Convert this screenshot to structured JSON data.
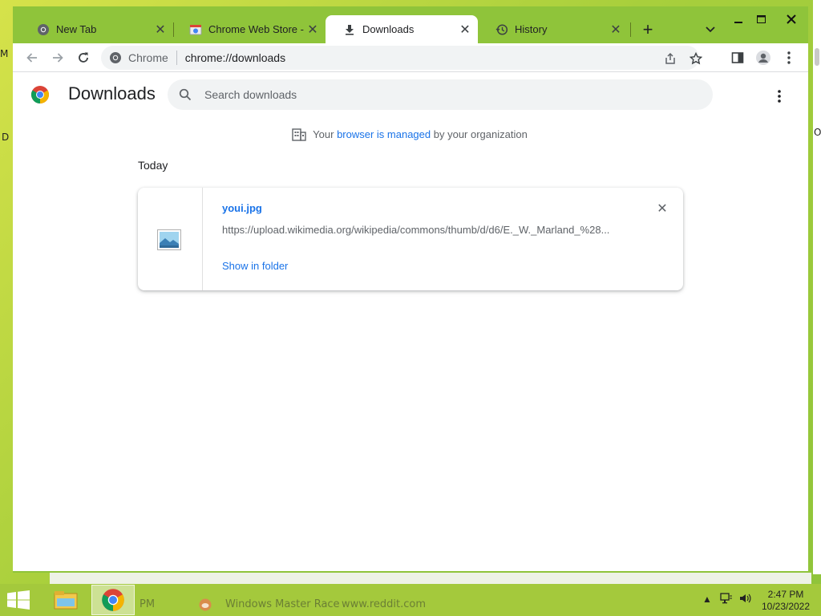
{
  "desktop": {
    "left_fragment_1": "M",
    "left_fragment_2": "D",
    "right_fragment": "O"
  },
  "tabs": [
    {
      "title": "New Tab",
      "icon": "chrome-icon",
      "active": false
    },
    {
      "title": "Chrome Web Store - Ex",
      "icon": "web-store-icon",
      "active": false
    },
    {
      "title": "Downloads",
      "icon": "download-icon",
      "active": true
    },
    {
      "title": "History",
      "icon": "history-icon",
      "active": false
    }
  ],
  "toolbar": {
    "site_chip": "Chrome",
    "url": "chrome://downloads"
  },
  "page": {
    "title": "Downloads",
    "search_placeholder": "Search downloads",
    "managed": {
      "prefix": "Your",
      "link": "browser is managed",
      "suffix": "by your organization"
    },
    "section": "Today",
    "downloads": [
      {
        "file_name": "youi.jpg",
        "url": "https://upload.wikimedia.org/wikipedia/commons/thumb/d/d6/E._W._Marland_%28...",
        "action": "Show in folder"
      }
    ]
  },
  "taskbar": {
    "ghost_time": "PM",
    "ghost_title": "Windows Master Race",
    "ghost_site": "www.reddit.com",
    "clock_time": "2:47 PM",
    "clock_date": "10/23/2022"
  },
  "colors": {
    "accent": "#1a73e8",
    "frame": "#8fc43a",
    "taskbar": "#a4c93c"
  }
}
